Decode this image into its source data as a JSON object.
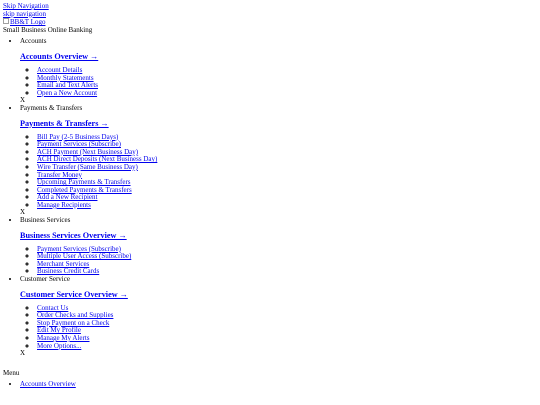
{
  "skip": {
    "skip_navigation": "Skip Navigation",
    "skip_navigation_lower": "skip navigation"
  },
  "logo": {
    "alt": "BB&T Logo"
  },
  "site_title": "Small Business Online Banking",
  "nav": {
    "close_label": "X",
    "sections": [
      {
        "label": "Accounts",
        "overview": "Accounts Overview →",
        "items": [
          "Account Details",
          "Monthly Statements",
          "Email and Text Alerts",
          "Open a New Account"
        ]
      },
      {
        "label": "Payments & Transfers",
        "overview": "Payments & Transfers →",
        "items": [
          "Bill Pay (2-5 Business Days)",
          "Payment Services (Subscribe)",
          "ACH Payment (Next Business Day)",
          "ACH Direct Deposits (Next Business Day)",
          "Wire Transfer (Same Business Day)",
          "Transfer Money",
          "Upcoming Payments & Transfers",
          "Completed Payments & Transfers",
          "Add a New Recipient",
          "Manage Recipients"
        ]
      },
      {
        "label": "Business Services",
        "overview": "Business Services Overview →",
        "items": [
          "Payment Services (Subscribe)",
          "Multiple User Access (Subscribe)",
          "Merchant Services",
          "Business Credit Cards"
        ]
      },
      {
        "label": "Customer Service",
        "overview": "Customer Service Overview →",
        "items": [
          "Contact Us",
          "Order Checks and Supplies",
          "Stop Payment on a Check",
          "Edit My Profile",
          "Manage My Alerts",
          "More Options..."
        ]
      }
    ]
  },
  "menu": {
    "label": "Menu",
    "items": [
      "Accounts Overview"
    ]
  }
}
